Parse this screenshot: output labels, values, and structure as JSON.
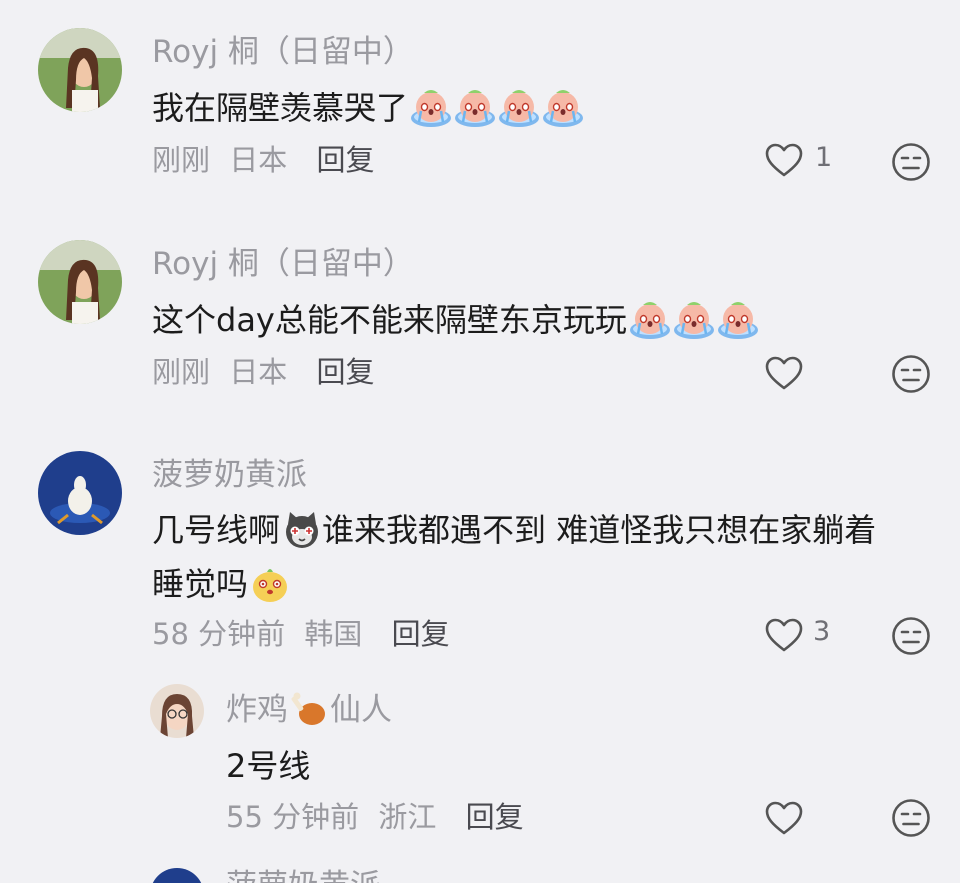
{
  "comments": [
    {
      "username": "Royj 桐（日留中）",
      "text": "我在隔壁羡慕哭了",
      "meta_time": "刚刚",
      "meta_location": "日本",
      "reply_label": "回复",
      "like_count": "1",
      "emoji": "crying-face-emoji"
    },
    {
      "username": "Royj 桐（日留中）",
      "text": "这个day总能不能来隔壁东京玩玩",
      "meta_time": "刚刚",
      "meta_location": "日本",
      "reply_label": "回复",
      "like_count": "",
      "emoji": "crying-face-emoji"
    },
    {
      "username": "菠萝奶黄派",
      "text_line1_a": "几号线啊",
      "text_line1_b": "谁来我都遇不到 难道怪我只想在家躺着",
      "text_line2": "睡觉吗",
      "meta_time": "58 分钟前",
      "meta_location": "韩国",
      "reply_label": "回复",
      "like_count": "3"
    },
    {
      "username_a": "炸鸡",
      "username_b": "仙人",
      "text": "2号线",
      "meta_time": "55 分钟前",
      "meta_location": "浙江",
      "reply_label": "回复",
      "like_count": ""
    },
    {
      "username": "菠萝奶黄派"
    }
  ],
  "colors": {
    "background": "#f1f1f4",
    "username": "#9a9aa0",
    "text": "#1c1c1c",
    "icon": "#555555"
  }
}
